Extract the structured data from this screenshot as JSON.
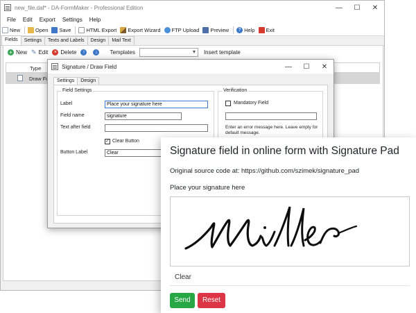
{
  "main_window": {
    "title": "new_file.daf* - DA-FormMaker - Professional Edition",
    "window_buttons": [
      "—",
      "☐",
      "✕"
    ],
    "menu": [
      "File",
      "Edit",
      "Export",
      "Settings",
      "Help"
    ],
    "toolbar": [
      {
        "label": "New",
        "icon": "new-file-icon",
        "color": "#9aa8b6"
      },
      {
        "label": "Open",
        "icon": "open-folder-icon",
        "color": "#e6b84a"
      },
      {
        "label": "Save",
        "icon": "save-icon",
        "color": "#3e77c7"
      },
      {
        "label": "HTML Export",
        "icon": "html-export-icon",
        "color": "#c9c9c9"
      },
      {
        "label": "Export Wizard",
        "icon": "wizard-icon",
        "color": "#d8a640"
      },
      {
        "label": "FTP Upload",
        "icon": "ftp-upload-icon",
        "color": "#4b8fd8"
      },
      {
        "label": "Preview",
        "icon": "preview-icon",
        "color": "#4f6fa8"
      },
      {
        "label": "Help",
        "icon": "help-icon",
        "color": "#3c78c8"
      },
      {
        "label": "Exit",
        "icon": "exit-icon",
        "color": "#d63a2f"
      }
    ],
    "tabs": [
      "Fields",
      "Settings",
      "Texts and Labels",
      "Design",
      "Mail Text"
    ],
    "active_tab": "Fields",
    "fields_toolbar": {
      "new": "New",
      "edit": "Edit",
      "delete": "Delete",
      "templates_label": "Templates",
      "templates_value": "",
      "insert_template": "Insert template"
    },
    "grid": {
      "columns": [
        "Type"
      ],
      "rows": [
        "Draw Field"
      ]
    }
  },
  "dialog": {
    "title": "Signature / Draw Field",
    "window_buttons": [
      "—",
      "☐",
      "✕"
    ],
    "tabs": [
      "Settings",
      "Design"
    ],
    "field_settings": {
      "legend": "Field Settings",
      "label_caption": "Label",
      "label_value": "Place your signature here",
      "field_name_caption": "Field name",
      "field_name_value": "signature",
      "text_after_caption": "Text after field",
      "text_after_value": "",
      "clear_button_caption": "Clear Button",
      "clear_button_checked": true,
      "button_label_caption": "Button Label",
      "button_label_value": "Clear"
    },
    "verification": {
      "legend": "Verification",
      "mandatory_caption": "Mandatory Field",
      "mandatory_checked": false,
      "error_value": "",
      "hint": "Enter an error message here. Leave empty for default message."
    }
  },
  "web_form": {
    "title": "Signature field in online form with Signature Pad",
    "source": "Original source code at: https://github.com/szimek/signature_pad",
    "field_label": "Place your signature here",
    "clear_label": "Clear",
    "send_label": "Send",
    "reset_label": "Reset",
    "colors": {
      "send": "#28a745",
      "reset": "#dc3545"
    }
  }
}
